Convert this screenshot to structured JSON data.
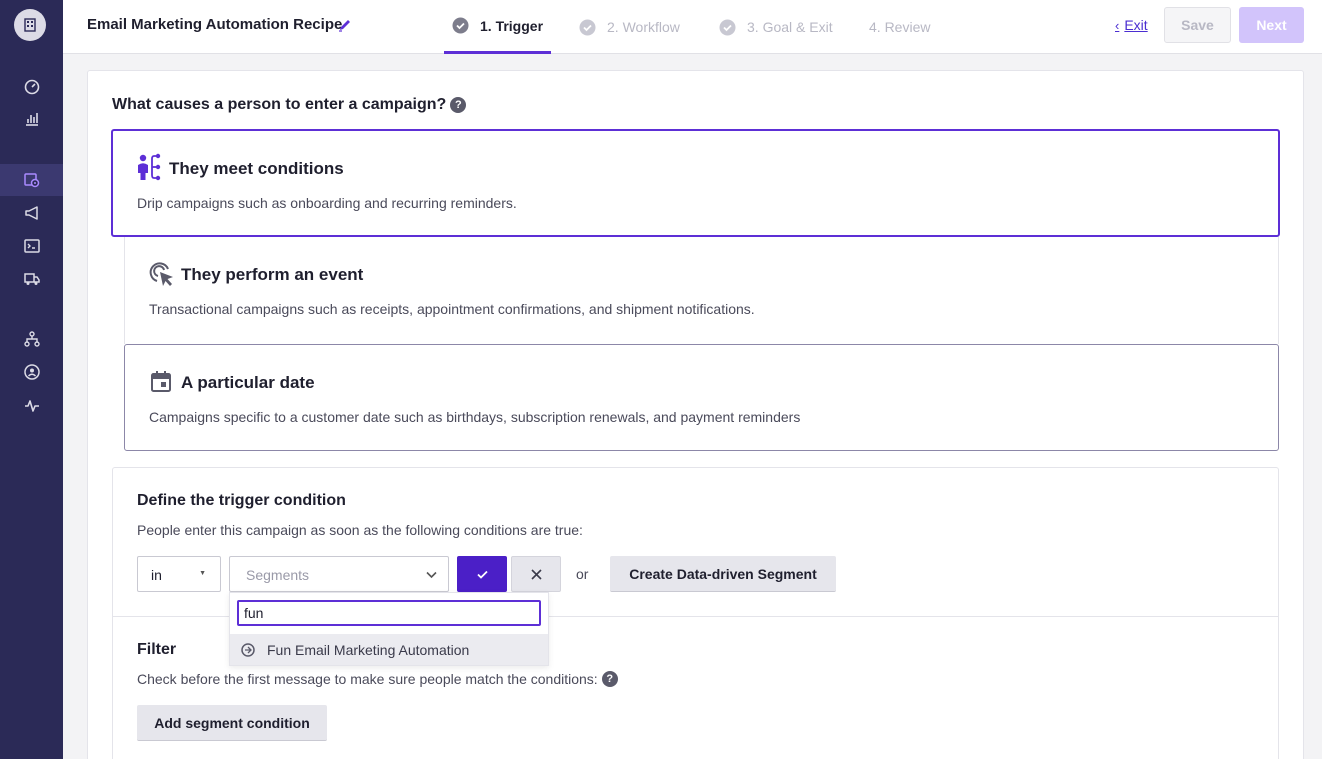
{
  "header": {
    "recipe_title": "Email Marketing Automation Recipe",
    "steps": [
      {
        "label": "1. Trigger",
        "state": "active"
      },
      {
        "label": "2. Workflow",
        "state": "disabled"
      },
      {
        "label": "3. Goal & Exit",
        "state": "disabled"
      },
      {
        "label": "4. Review",
        "state": "disabled"
      }
    ],
    "exit_label": "Exit",
    "save_label": "Save",
    "next_label": "Next"
  },
  "sidebar": {
    "icons": [
      "building-icon",
      "dashboard-gauge-icon",
      "bar-chart-icon",
      "campaigns-icon",
      "broadcast-megaphone-icon",
      "terminal-icon",
      "delivery-truck-icon",
      "hierarchy-icon",
      "people-circle-icon",
      "activity-pulse-icon"
    ],
    "active": "campaigns-icon"
  },
  "trigger": {
    "question": "What causes a person to enter a campaign?",
    "options": [
      {
        "title": "They meet conditions",
        "desc": "Drip campaigns such as onboarding and recurring reminders.",
        "selected": true
      },
      {
        "title": "They perform an event",
        "desc": "Transactional campaigns such as receipts, appointment confirmations, and shipment notifications.",
        "selected": false
      },
      {
        "title": "A particular date",
        "desc": "Campaigns specific to a customer date such as birthdays, subscription renewals, and payment reminders",
        "selected": false
      }
    ]
  },
  "condition": {
    "title": "Define the trigger condition",
    "desc": "People enter this campaign as soon as the following conditions are true:",
    "operator_value": "in",
    "segments_placeholder": "Segments",
    "search_value": "fun",
    "results": [
      "Fun Email Marketing Automation"
    ],
    "or_text": "or",
    "create_label": "Create Data-driven Segment"
  },
  "filter": {
    "title": "Filter",
    "desc": "Check before the first message to make sure people match the conditions:",
    "add_label": "Add segment condition"
  },
  "help_glyph": "?",
  "colors": {
    "sidebar": "#2b2a57",
    "accent": "#5d2fd6",
    "confirm": "#4b1fc7",
    "next_disabled": "#d2c4fb"
  }
}
